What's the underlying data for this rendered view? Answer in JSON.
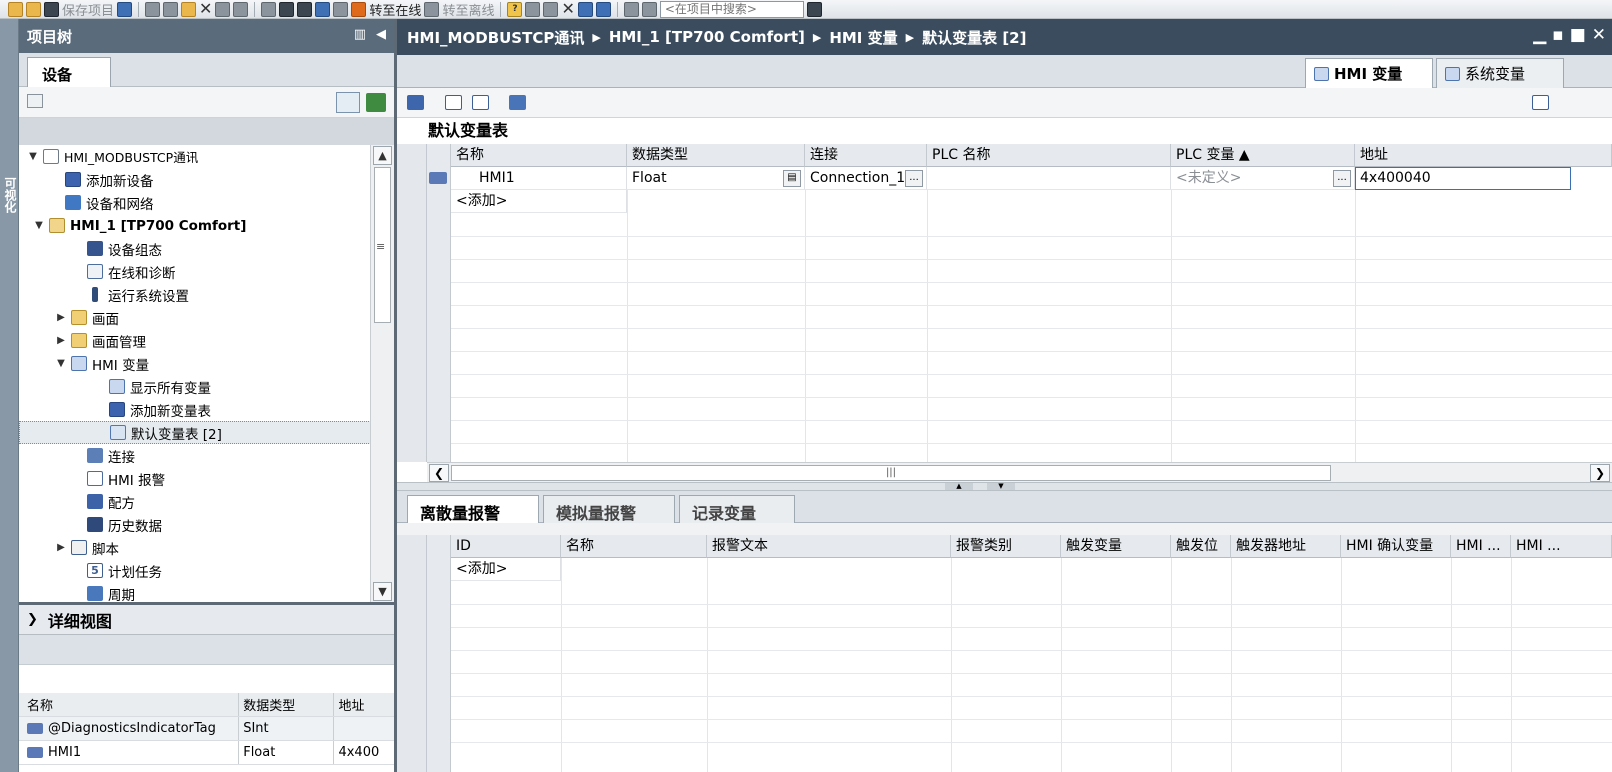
{
  "toolbar": {
    "save_project": "保存项目",
    "go_online": "转至在线",
    "go_offline": "转至离线",
    "search_placeholder": "<在项目中搜索>"
  },
  "side_strip": {
    "label": "可视化"
  },
  "project_tree": {
    "title": "项目树",
    "device_tab": "设备",
    "items": [
      {
        "label": "HMI_MODBUSTCP通讯",
        "level": 0,
        "expand": "down",
        "icon": "doc-icon"
      },
      {
        "label": "添加新设备",
        "level": 1,
        "expand": "",
        "icon": "add-device-icon"
      },
      {
        "label": "设备和网络",
        "level": 1,
        "expand": "",
        "icon": "network-icon"
      },
      {
        "label": "HMI_1 [TP700 Comfort]",
        "level": 1,
        "expand": "down",
        "icon": "hmi-device-icon"
      },
      {
        "label": "设备组态",
        "level": 2,
        "expand": "",
        "icon": "device-config-icon"
      },
      {
        "label": "在线和诊断",
        "level": 2,
        "expand": "",
        "icon": "diagnostics-icon"
      },
      {
        "label": "运行系统设置",
        "level": 2,
        "expand": "",
        "icon": "runtime-settings-icon"
      },
      {
        "label": "画面",
        "level": 2,
        "expand": "right",
        "icon": "folder-icon"
      },
      {
        "label": "画面管理",
        "level": 2,
        "expand": "right",
        "icon": "folder-icon"
      },
      {
        "label": "HMI 变量",
        "level": 2,
        "expand": "down",
        "icon": "hmi-tags-icon"
      },
      {
        "label": "显示所有变量",
        "level": 3,
        "expand": "",
        "icon": "show-tags-icon"
      },
      {
        "label": "添加新变量表",
        "level": 3,
        "expand": "",
        "icon": "add-table-icon"
      },
      {
        "label": "默认变量表 [2]",
        "level": 3,
        "expand": "",
        "icon": "tag-table-icon"
      },
      {
        "label": "连接",
        "level": 2,
        "expand": "",
        "icon": "connection-icon"
      },
      {
        "label": "HMI 报警",
        "level": 2,
        "expand": "",
        "icon": "alarm-icon"
      },
      {
        "label": "配方",
        "level": 2,
        "expand": "",
        "icon": "recipe-icon"
      },
      {
        "label": "历史数据",
        "level": 2,
        "expand": "",
        "icon": "history-icon"
      },
      {
        "label": "脚本",
        "level": 2,
        "expand": "right",
        "icon": "script-icon"
      },
      {
        "label": "计划任务",
        "level": 2,
        "expand": "",
        "icon": "schedule-icon"
      },
      {
        "label": "周期",
        "level": 2,
        "expand": "",
        "icon": "cycle-icon"
      }
    ]
  },
  "details_view": {
    "title": "详细视图",
    "columns": [
      "名称",
      "数据类型",
      "地址"
    ],
    "rows": [
      [
        "@DiagnosticsIndicatorTag",
        "SInt",
        ""
      ],
      [
        "HMI1",
        "Float",
        "4x400"
      ]
    ]
  },
  "breadcrumb": [
    "HMI_MODBUSTCP通讯",
    "HMI_1 [TP700 Comfort]",
    "HMI 变量",
    "默认变量表 [2]"
  ],
  "main_tabs": [
    "HMI 变量",
    "系统变量"
  ],
  "tag_table": {
    "title": "默认变量表",
    "columns": [
      "名称",
      "数据类型",
      "连接",
      "PLC 名称",
      "PLC 变量 ▲",
      "地址"
    ],
    "row": {
      "name": "HMI1",
      "data_type": "Float",
      "connection": "Connection_1",
      "plc_name": "",
      "plc_tag": "<未定义>",
      "address": "4x400040"
    },
    "add_label": "<添加>"
  },
  "alarm_tabs": [
    "离散量报警",
    "模拟量报警",
    "记录变量"
  ],
  "alarm_table": {
    "columns": [
      "ID",
      "名称",
      "报警文本",
      "报警类别",
      "触发变量",
      "触发位",
      "触发器地址",
      "HMI 确认变量",
      "HMI ...",
      "HMI ..."
    ],
    "add_label": "<添加>"
  },
  "colors": {
    "header_dark": "#3a4c5e",
    "panel_header": "#5a6b7b",
    "address_border": "#3a6fb3"
  }
}
